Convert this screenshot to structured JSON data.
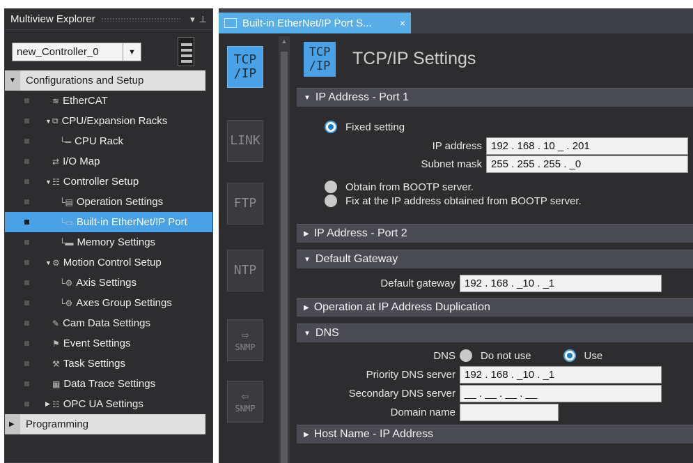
{
  "explorer": {
    "title": "Multiview Explorer",
    "controller": "new_Controller_0",
    "section_config": "Configurations and Setup",
    "items": [
      {
        "label": "EtherCAT",
        "icon": "ethercat-icon",
        "glyph": "≋",
        "indent": 1,
        "twisty": ""
      },
      {
        "label": "CPU/Expansion Racks",
        "icon": "rack-icon",
        "glyph": "⧉",
        "indent": 1,
        "twisty": "▼"
      },
      {
        "label": "CPU Rack",
        "icon": "cpu-rack-icon",
        "glyph": "└═",
        "indent": 2,
        "twisty": ""
      },
      {
        "label": "I/O Map",
        "icon": "io-map-icon",
        "glyph": "⇄",
        "indent": 1,
        "twisty": ""
      },
      {
        "label": "Controller Setup",
        "icon": "controller-setup-icon",
        "glyph": "☷",
        "indent": 1,
        "twisty": "▼"
      },
      {
        "label": "Operation Settings",
        "icon": "operation-settings-icon",
        "glyph": "└▤",
        "indent": 2,
        "twisty": ""
      },
      {
        "label": "Built-in EtherNet/IP Port",
        "icon": "ethernet-port-icon",
        "glyph": "└▭",
        "indent": 2,
        "twisty": "",
        "selected": true
      },
      {
        "label": "Memory Settings",
        "icon": "memory-icon",
        "glyph": "└▬",
        "indent": 2,
        "twisty": ""
      },
      {
        "label": "Motion Control Setup",
        "icon": "motion-icon",
        "glyph": "⚙",
        "indent": 1,
        "twisty": "▼"
      },
      {
        "label": "Axis Settings",
        "icon": "axis-icon",
        "glyph": "└⚙",
        "indent": 2,
        "twisty": ""
      },
      {
        "label": "Axes Group Settings",
        "icon": "axes-group-icon",
        "glyph": "└⚙",
        "indent": 2,
        "twisty": ""
      },
      {
        "label": "Cam Data Settings",
        "icon": "cam-icon",
        "glyph": "✎",
        "indent": 1,
        "twisty": ""
      },
      {
        "label": "Event Settings",
        "icon": "event-icon",
        "glyph": "⚑",
        "indent": 1,
        "twisty": ""
      },
      {
        "label": "Task Settings",
        "icon": "task-icon",
        "glyph": "⚒",
        "indent": 1,
        "twisty": ""
      },
      {
        "label": "Data Trace Settings",
        "icon": "data-trace-icon",
        "glyph": "▦",
        "indent": 1,
        "twisty": ""
      },
      {
        "label": "OPC UA Settings",
        "icon": "opc-ua-icon",
        "glyph": "☷",
        "indent": 1,
        "twisty": "▶"
      }
    ],
    "section_programming": "Programming"
  },
  "tab": {
    "label": "Built-in EtherNet/IP Port S...",
    "close": "×"
  },
  "rail": [
    {
      "id": "tcpip",
      "text": "TCP\n/IP",
      "active": true
    },
    {
      "id": "link",
      "text": "LINK",
      "active": false
    },
    {
      "id": "ftp",
      "text": "FTP",
      "active": false
    },
    {
      "id": "ntp",
      "text": "NTP",
      "active": false
    },
    {
      "id": "snmp",
      "text": "SNMP",
      "arrow": "⇨",
      "active": false
    },
    {
      "id": "snmp-trap",
      "text": "SNMP",
      "arrow": "⇦",
      "active": false
    }
  ],
  "settings": {
    "logo": "TCP\n/IP",
    "title": "TCP/IP Settings",
    "port1": {
      "header": "IP Address - Port 1",
      "fixed": "Fixed setting",
      "ip_label": "IP address",
      "ip_value": "192 . 168 . 10 _ . 201",
      "mask_label": "Subnet mask",
      "mask_value": "255 . 255 . 255 . _0",
      "bootp": "Obtain from BOOTP server.",
      "bootp_fix": "Fix at the IP address obtained from BOOTP server."
    },
    "port2": {
      "header": "IP Address - Port 2"
    },
    "gateway": {
      "header": "Default Gateway",
      "label": "Default gateway",
      "value": "192 . 168 . _10 . _1"
    },
    "dup": {
      "header": "Operation at IP Address Duplication"
    },
    "dns": {
      "header": "DNS",
      "label": "DNS",
      "not_use": "Do not use",
      "use": "Use",
      "priority_label": "Priority DNS server",
      "priority_value": "192 . 168 . _10 . _1",
      "secondary_label": "Secondary DNS server",
      "secondary_value": "__ . __ . __ . __",
      "domain_label": "Domain name",
      "domain_value": ""
    },
    "hostname": {
      "header": "Host Name - IP Address"
    }
  },
  "colors": {
    "accent": "#4aa1e6",
    "panel": "#2d2d30",
    "header": "#4a4a52"
  }
}
